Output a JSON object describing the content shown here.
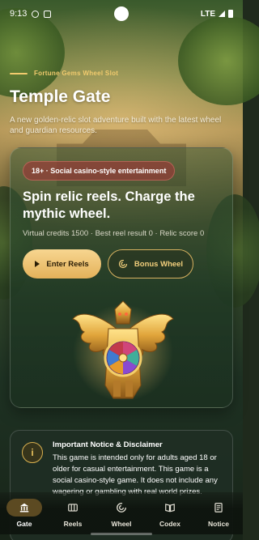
{
  "status_bar": {
    "time": "9:13",
    "network": "LTE"
  },
  "header": {
    "kicker": "Fortune Gems Wheel Slot",
    "title": "Temple Gate",
    "subtitle": "A new golden-relic slot adventure built with the latest wheel and guardian resources."
  },
  "card": {
    "badge": "18+ · Social casino-style entertainment",
    "headline": "Spin relic reels. Charge the mythic wheel.",
    "stats": "Virtual credits 1500 · Best reel result 0 · Relic score 0",
    "primary_button": "Enter Reels",
    "secondary_button": "Bonus Wheel"
  },
  "notice": {
    "title": "Important Notice & Disclaimer",
    "text": "This game is intended only for adults aged 18 or older for casual entertainment. This game is a social casino-style game. It does not include any wagering or gambling with real world prizes."
  },
  "nav": {
    "items": [
      {
        "label": "Gate",
        "icon": "temple-icon",
        "active": true
      },
      {
        "label": "Reels",
        "icon": "reels-icon",
        "active": false
      },
      {
        "label": "Wheel",
        "icon": "wheel-icon",
        "active": false
      },
      {
        "label": "Codex",
        "icon": "book-icon",
        "active": false
      },
      {
        "label": "Notice",
        "icon": "notice-icon",
        "active": false
      }
    ]
  },
  "colors": {
    "accent_gold": "#f2cb6e",
    "badge_red": "#963c37",
    "nav_active": "#5c4a22"
  }
}
